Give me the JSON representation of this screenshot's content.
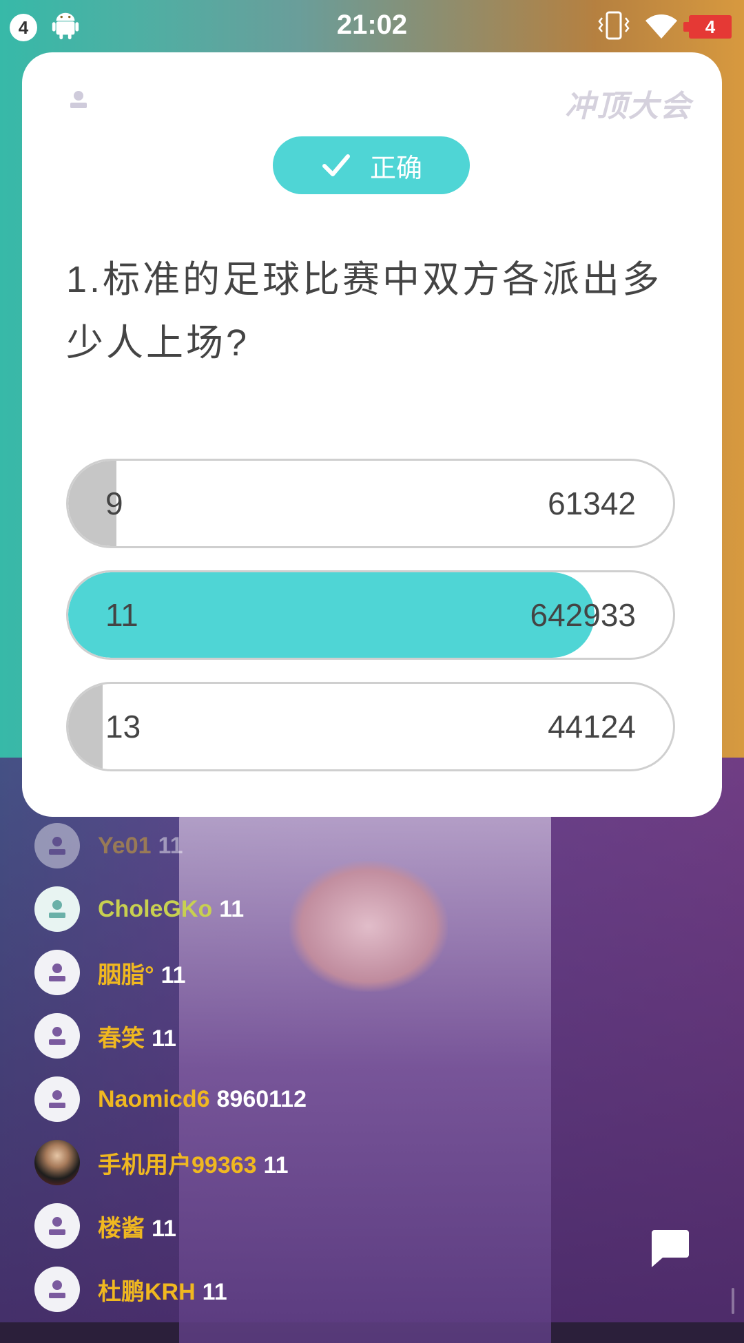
{
  "status_bar": {
    "notification_count": "4",
    "time": "21:02",
    "battery_level": "4",
    "icons": [
      "android-icon",
      "vibrate-icon",
      "wifi-icon",
      "battery-icon"
    ]
  },
  "card": {
    "logo_text": "冲顶大会",
    "result_label": "正确",
    "question": "1.标准的足球比赛中双方各派出多少人上场?",
    "options": [
      {
        "label": "9",
        "count": "61342",
        "fill_fraction": 0.08,
        "state": "wrong"
      },
      {
        "label": "11",
        "count": "642933",
        "fill_fraction": 0.86,
        "state": "correct"
      },
      {
        "label": "13",
        "count": "44124",
        "fill_fraction": 0.06,
        "state": "wrong"
      }
    ],
    "accent_color": "#4fd5d5",
    "neutral_fill_color": "#c6c6c6"
  },
  "comments": [
    {
      "name": "Ye01",
      "message": "11",
      "avatar": "default"
    },
    {
      "name": "CholeGKo",
      "message": "11",
      "avatar": "default"
    },
    {
      "name": "胭脂°",
      "message": "11",
      "avatar": "default"
    },
    {
      "name": "春笑",
      "message": "11",
      "avatar": "default"
    },
    {
      "name": "Naomicd6",
      "message": "8960112",
      "avatar": "default"
    },
    {
      "name": "手机用户99363",
      "message": "11",
      "avatar": "photo"
    },
    {
      "name": "楼酱",
      "message": "11",
      "avatar": "default"
    },
    {
      "name": "杜鹏KRH",
      "message": "11",
      "avatar": "default"
    }
  ],
  "colors": {
    "username": "#f0b820",
    "message": "#ffffff",
    "battery": "#e53935"
  }
}
